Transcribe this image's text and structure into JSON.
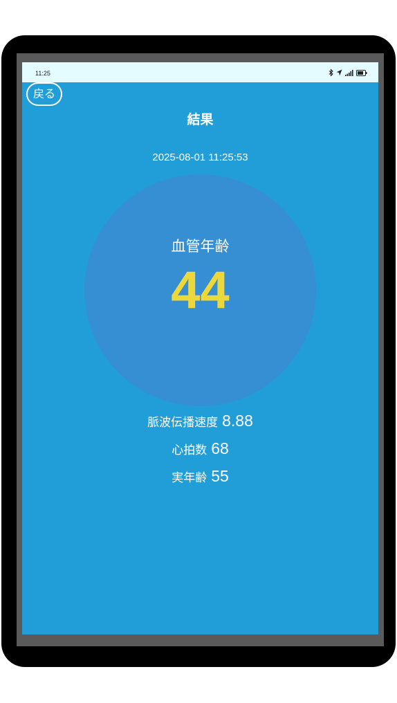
{
  "status_bar": {
    "time": "11:25",
    "icons": [
      "bluetooth-icon",
      "navigation-arrow-icon",
      "signal-bars-icon",
      "battery-icon"
    ]
  },
  "header": {
    "back_label": "戻る",
    "title": "結果"
  },
  "result": {
    "timestamp": "2025-08-01 11:25:53",
    "vascular_age_label": "血管年齢",
    "vascular_age_value": "44"
  },
  "metrics": {
    "pwv_label": "脈波伝播速度",
    "pwv_value": "8.88",
    "heart_rate_label": "心拍数",
    "heart_rate_value": "68",
    "real_age_label": "実年齢",
    "real_age_value": "55"
  },
  "colors": {
    "screen_background": "#219ed7",
    "circle_background": "#368ed3",
    "age_value": "#ecd83b",
    "status_bar": "#e4fbff",
    "text": "#ffffff"
  }
}
